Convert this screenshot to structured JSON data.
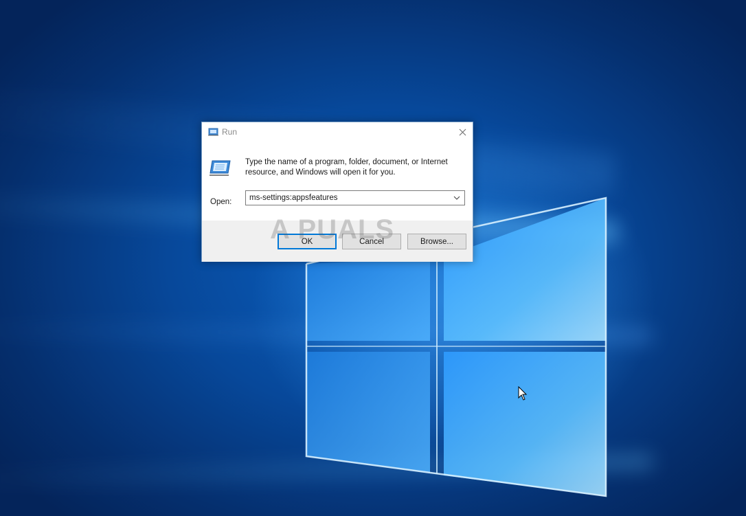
{
  "desktop": {
    "watermark": "A  PUALS",
    "colors": {
      "background_dark": "#052f6e",
      "background_mid": "#0a5fbf",
      "glow": "#5ab4ff"
    }
  },
  "run_dialog": {
    "title": "Run",
    "title_icon": "run-app-icon",
    "close_icon": "close-icon",
    "description": "Type the name of a program, folder, document, or Internet resource, and Windows will open it for you.",
    "open_label": "Open:",
    "open_value": "ms-settings:appsfeatures",
    "dropdown_icon": "chevron-down-icon",
    "buttons": {
      "ok": "OK",
      "cancel": "Cancel",
      "browse": "Browse..."
    },
    "colors": {
      "accent": "#0078d7",
      "footer": "#f0f0f0"
    }
  }
}
